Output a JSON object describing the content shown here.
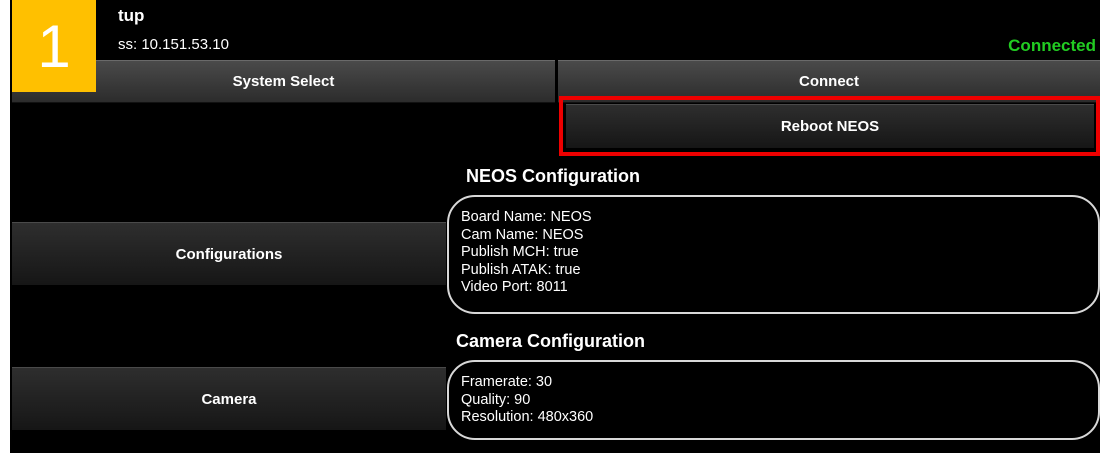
{
  "header": {
    "title": "tup",
    "ip_line": "ss: 10.151.53.10",
    "status": "Connected"
  },
  "buttons": {
    "system_select": "System Select",
    "connect": "Connect",
    "reboot": "Reboot NEOS",
    "configurations": "Configurations",
    "camera": "Camera"
  },
  "neos_config": {
    "title": "NEOS Configuration",
    "lines": [
      "Board Name: NEOS",
      "Cam Name: NEOS",
      "Publish MCH: true",
      "Publish ATAK: true",
      "Video Port: 8011"
    ]
  },
  "camera_config": {
    "title": "Camera Configuration",
    "lines": [
      "Framerate: 30",
      "Quality: 90",
      "Resolution: 480x360"
    ]
  },
  "annotation": {
    "badge_number": "1",
    "badge_color": "#ffc000",
    "highlight_color": "#ee0000"
  },
  "colors": {
    "status_green": "#22cc22"
  }
}
